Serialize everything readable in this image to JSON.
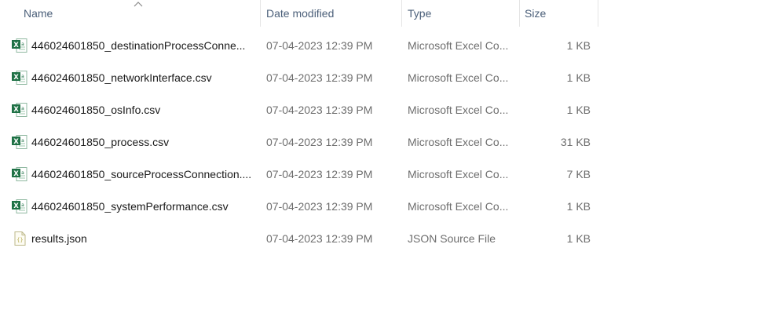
{
  "columns": {
    "name": "Name",
    "date_modified": "Date modified",
    "type": "Type",
    "size": "Size"
  },
  "sort": {
    "column": "name",
    "direction": "ascending",
    "icon": "chevron-up-icon"
  },
  "files": [
    {
      "icon": "excel-icon",
      "name": "446024601850_destinationProcessConne...",
      "date": "07-04-2023 12:39 PM",
      "type": "Microsoft Excel Co...",
      "size": "1 KB"
    },
    {
      "icon": "excel-icon",
      "name": "446024601850_networkInterface.csv",
      "date": "07-04-2023 12:39 PM",
      "type": "Microsoft Excel Co...",
      "size": "1 KB"
    },
    {
      "icon": "excel-icon",
      "name": "446024601850_osInfo.csv",
      "date": "07-04-2023 12:39 PM",
      "type": "Microsoft Excel Co...",
      "size": "1 KB"
    },
    {
      "icon": "excel-icon",
      "name": "446024601850_process.csv",
      "date": "07-04-2023 12:39 PM",
      "type": "Microsoft Excel Co...",
      "size": "31 KB"
    },
    {
      "icon": "excel-icon",
      "name": "446024601850_sourceProcessConnection....",
      "date": "07-04-2023 12:39 PM",
      "type": "Microsoft Excel Co...",
      "size": "7 KB"
    },
    {
      "icon": "excel-icon",
      "name": "446024601850_systemPerformance.csv",
      "date": "07-04-2023 12:39 PM",
      "type": "Microsoft Excel Co...",
      "size": "1 KB"
    },
    {
      "icon": "json-icon",
      "name": "results.json",
      "date": "07-04-2023 12:39 PM",
      "type": "JSON Source File",
      "size": "1 KB"
    }
  ],
  "colors": {
    "header_text": "#4c607a",
    "name_text": "#1a1a1a",
    "detail_text": "#6d6d6d",
    "excel_green": "#1e7145",
    "json_yellow": "#c9c27a"
  }
}
